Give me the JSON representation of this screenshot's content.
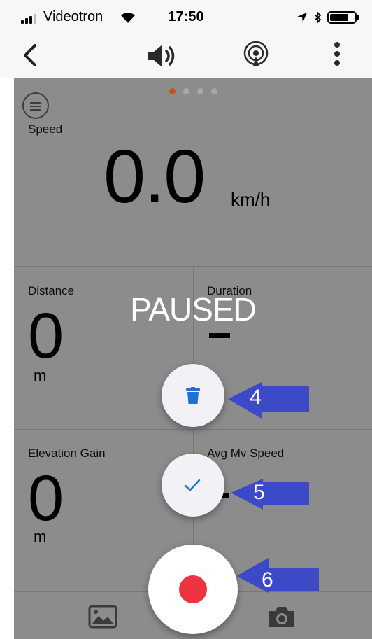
{
  "status_bar": {
    "carrier": "Videotron",
    "time": "17:50"
  },
  "toolbar": {
    "icons": [
      "back-chevron-icon",
      "speaker-icon",
      "broadcast-icon",
      "more-vertical-icon"
    ]
  },
  "pager": {
    "count": 4,
    "active_index": 0,
    "active_color": "#c4521c"
  },
  "speed": {
    "label": "Speed",
    "value": "0.0",
    "unit": "km/h"
  },
  "distance": {
    "label": "Distance",
    "value": "0",
    "unit": "m"
  },
  "duration": {
    "label": "Duration"
  },
  "elevation": {
    "label": "Elevation Gain",
    "value": "0",
    "unit": "m"
  },
  "avg_speed": {
    "label": "Avg Mv Speed"
  },
  "overlay": {
    "status": "PAUSED"
  },
  "actions": {
    "delete_icon": "trash-icon",
    "finish_icon": "checkmark-icon",
    "record_icon": "record-dot-icon",
    "record_color": "#ee3340"
  },
  "annotations": [
    {
      "number": "4"
    },
    {
      "number": "5"
    },
    {
      "number": "6"
    }
  ],
  "bottom_bar": {
    "icons": [
      "gallery-icon",
      "camera-icon"
    ]
  },
  "colors": {
    "arrow": "#3d4ac7",
    "accent_blue": "#1f72d4"
  }
}
